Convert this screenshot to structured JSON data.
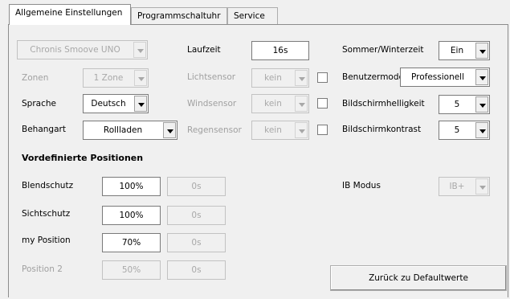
{
  "tabs": [
    {
      "label": "Allgemeine Einstellungen"
    },
    {
      "label": "Programmschaltuhr"
    },
    {
      "label": "Service"
    }
  ],
  "left": {
    "device": "Chronis Smoove UNO",
    "zonen_label": "Zonen",
    "zonen_value": "1 Zone",
    "sprache_label": "Sprache",
    "sprache_value": "Deutsch",
    "behang_label": "Behangart",
    "behang_value": "Rollladen"
  },
  "middle": {
    "laufzeit_label": "Laufzeit",
    "laufzeit_value": "16s",
    "licht_label": "Lichtsensor",
    "licht_value": "kein",
    "wind_label": "Windsensor",
    "wind_value": "kein",
    "regen_label": "Regensensor",
    "regen_value": "kein"
  },
  "right": {
    "sommer_label": "Sommer/Winterzeit",
    "sommer_value": "Ein",
    "benutzer_label": "Benutzermode",
    "benutzer_value": "Professionell",
    "hell_label": "Bildschirmhelligkeit",
    "hell_value": "5",
    "kontrast_label": "Bildschirmkontrast",
    "kontrast_value": "5",
    "ib_label": "IB Modus",
    "ib_value": "IB+",
    "default_button": "Zurück zu Defaultwerte"
  },
  "positions": {
    "heading": "Vordefinierte Positionen",
    "rows": [
      {
        "label": "Blendschutz",
        "percent": "100%",
        "time": "0s"
      },
      {
        "label": "Sichtschutz",
        "percent": "100%",
        "time": "0s"
      },
      {
        "label": "my Position",
        "percent": "70%",
        "time": "0s"
      },
      {
        "label": "Position 2",
        "percent": "50%",
        "time": "0s"
      }
    ]
  }
}
